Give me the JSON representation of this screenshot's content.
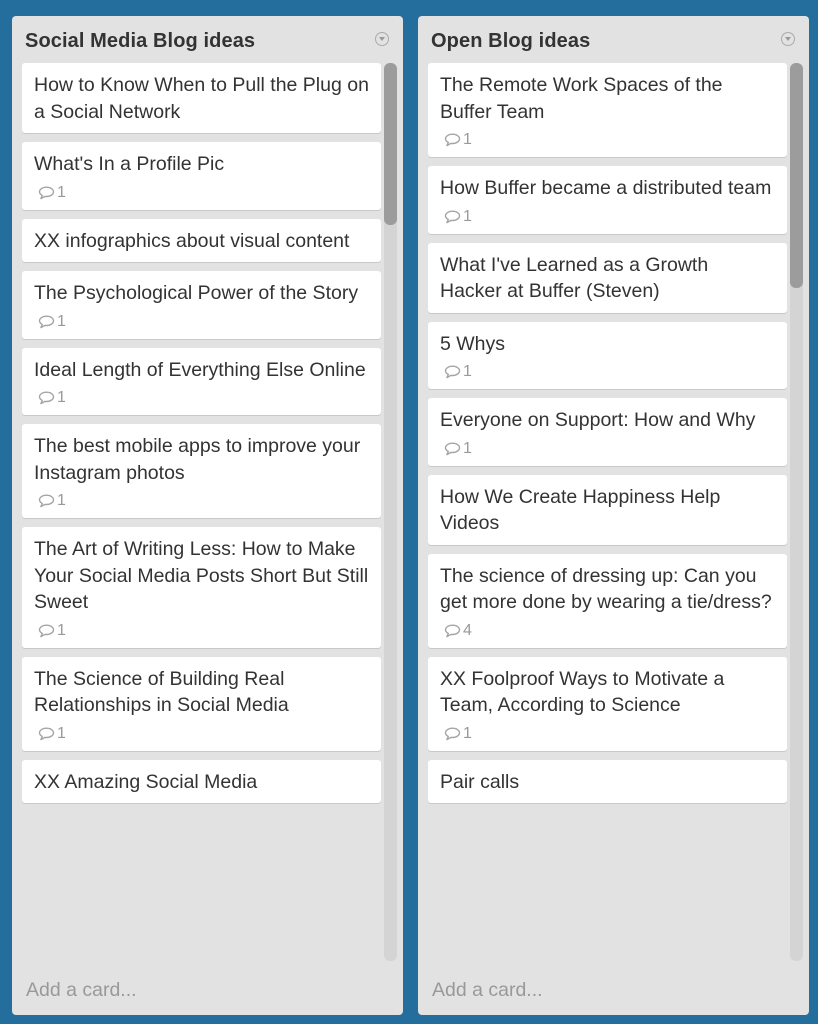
{
  "board": {
    "background_color": "#236e9d",
    "lists": [
      {
        "title": "Social Media Blog ideas",
        "menu_icon": "chevron-down-circle-icon",
        "add_card_label": "Add a card...",
        "scroll_position": 0,
        "scroll_visible_fraction": 0.18,
        "cards": [
          {
            "title": "How to Know When to Pull the Plug on a Social Network",
            "comments": null
          },
          {
            "title": "What's In a Profile Pic",
            "comments": "1"
          },
          {
            "title": "XX infographics about visual content",
            "comments": null
          },
          {
            "title": "The Psychological Power of the Story",
            "comments": "1"
          },
          {
            "title": "Ideal Length of Everything Else Online",
            "comments": "1"
          },
          {
            "title": "The best mobile apps to improve your Instagram photos",
            "comments": "1"
          },
          {
            "title": "The Art of Writing Less: How to Make Your Social Media Posts Short But Still Sweet",
            "comments": "1"
          },
          {
            "title": "The Science of Building Real Relationships in Social Media",
            "comments": "1"
          },
          {
            "title": "XX Amazing Social Media",
            "comments": null
          }
        ]
      },
      {
        "title": "Open Blog ideas",
        "menu_icon": "chevron-down-circle-icon",
        "add_card_label": "Add a card...",
        "scroll_position": 0,
        "scroll_visible_fraction": 0.25,
        "cards": [
          {
            "title": "The Remote Work Spaces of the Buffer Team",
            "comments": "1"
          },
          {
            "title": "How Buffer became a distributed team",
            "comments": "1"
          },
          {
            "title": "What I've Learned as a Growth Hacker at Buffer (Steven)",
            "comments": null
          },
          {
            "title": "5 Whys",
            "comments": "1"
          },
          {
            "title": "Everyone on Support: How and Why",
            "comments": "1"
          },
          {
            "title": "How We Create Happiness Help Videos",
            "comments": null
          },
          {
            "title": "The science of dressing up: Can you get more done by wearing a tie/dress?",
            "comments": "4"
          },
          {
            "title": "XX Foolproof Ways to Motivate a Team, According to Science",
            "comments": "1"
          },
          {
            "title": "Pair calls",
            "comments": null
          }
        ]
      }
    ]
  }
}
